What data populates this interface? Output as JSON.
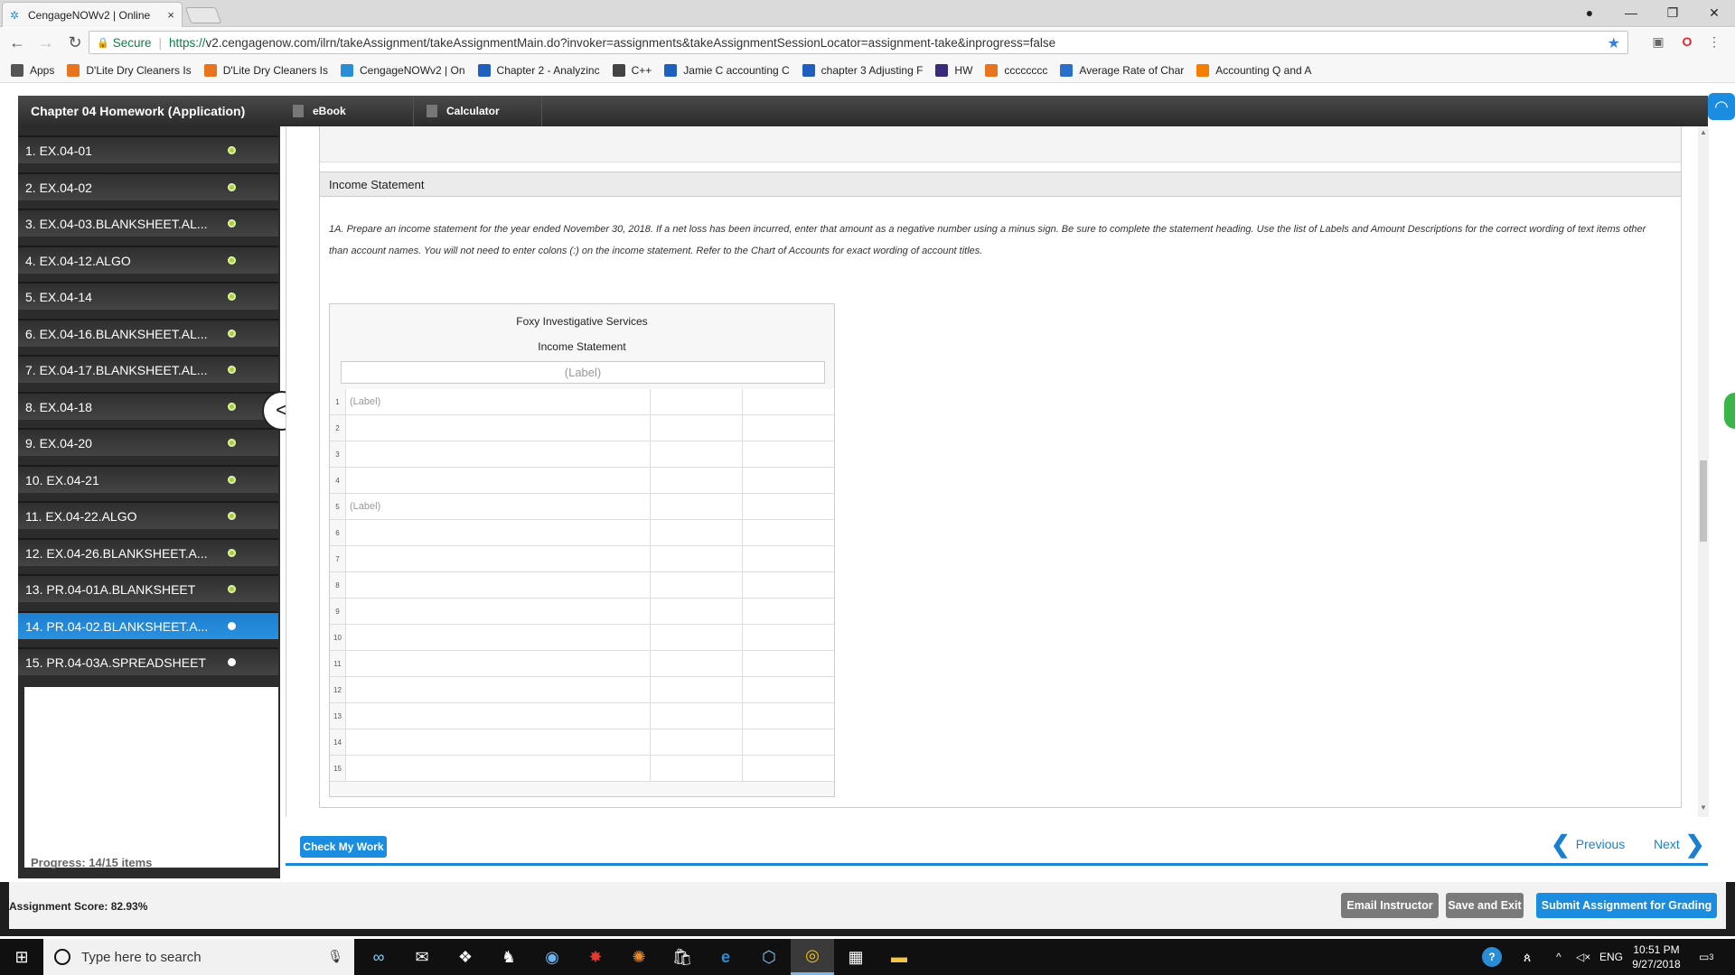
{
  "browser": {
    "tab_title": "CengageNOWv2 | Online",
    "tab_close": "×",
    "secure_label": "Secure",
    "url_https": "https://",
    "url_rest": "v2.cengagenow.com/ilrn/takeAssignment/takeAssignmentMain.do?invoker=assignments&takeAssignmentSessionLocator=assignment-take&inprogress=false",
    "bookmarks": [
      {
        "label": "Apps",
        "icon": "apps-icon",
        "color": "#555"
      },
      {
        "label": "D'Lite Dry Cleaners Is",
        "icon": "c-icon",
        "color": "#e8741e"
      },
      {
        "label": "D'Lite Dry Cleaners Is",
        "icon": "c-icon",
        "color": "#e8741e"
      },
      {
        "label": "CengageNOWv2 | On",
        "icon": "cengage-icon",
        "color": "#2b8dd6"
      },
      {
        "label": "Chapter 2 - Analyzinc",
        "icon": "q-icon",
        "color": "#1f5fbf"
      },
      {
        "label": "C++",
        "icon": "cpp-icon",
        "color": "#444"
      },
      {
        "label": "Jamie C accounting C",
        "icon": "q-icon",
        "color": "#1f5fbf"
      },
      {
        "label": "chapter 3 Adjusting F",
        "icon": "q-icon",
        "color": "#1f5fbf"
      },
      {
        "label": "HW",
        "icon": "hw-icon",
        "color": "#3b2a7a"
      },
      {
        "label": "cccccccc",
        "icon": "c-icon",
        "color": "#e8741e"
      },
      {
        "label": "Average Rate of Char",
        "icon": "check-icon",
        "color": "#2a6fc9"
      },
      {
        "label": "Accounting Q and A",
        "icon": "b-icon",
        "color": "#f57d00"
      }
    ]
  },
  "assignment": {
    "title": "Chapter 04 Homework (Application)",
    "tools": {
      "ebook": "eBook",
      "calculator": "Calculator"
    },
    "questions": [
      {
        "label": "1. EX.04-01",
        "status": "done"
      },
      {
        "label": "2. EX.04-02",
        "status": "done"
      },
      {
        "label": "3. EX.04-03.BLANKSHEET.AL...",
        "status": "done"
      },
      {
        "label": "4. EX.04-12.ALGO",
        "status": "done"
      },
      {
        "label": "5. EX.04-14",
        "status": "done"
      },
      {
        "label": "6. EX.04-16.BLANKSHEET.AL...",
        "status": "done"
      },
      {
        "label": "7. EX.04-17.BLANKSHEET.AL...",
        "status": "done"
      },
      {
        "label": "8. EX.04-18",
        "status": "done"
      },
      {
        "label": "9. EX.04-20",
        "status": "done"
      },
      {
        "label": "10. EX.04-21",
        "status": "done"
      },
      {
        "label": "11. EX.04-22.ALGO",
        "status": "done"
      },
      {
        "label": "12. EX.04-26.BLANKSHEET.A...",
        "status": "done"
      },
      {
        "label": "13. PR.04-01A.BLANKSHEET",
        "status": "done"
      },
      {
        "label": "14. PR.04-02.BLANKSHEET.A...",
        "status": "active"
      },
      {
        "label": "15. PR.04-03A.SPREADSHEET",
        "status": "open"
      }
    ],
    "progress": "Progress:  14/15 items",
    "collapse_glyph": "<"
  },
  "problem": {
    "section_title": "Income Statement",
    "instructions": "1A. Prepare an income statement for the year ended November 30, 2018. If a net loss has been incurred, enter that amount as a negative number using a minus sign. Be sure to complete the statement heading. Use the list of Labels and Amount Descriptions for the correct wording of text items other than account names. You will not need to enter colons (:) on the income statement. Refer to the Chart of Accounts for exact wording of account titles.",
    "company": "Foxy Investigative Services",
    "statement_name": "Income Statement",
    "heading_placeholder": "(Label)",
    "rows": [
      {
        "n": "1",
        "label": "(Label)"
      },
      {
        "n": "2",
        "label": ""
      },
      {
        "n": "3",
        "label": ""
      },
      {
        "n": "4",
        "label": ""
      },
      {
        "n": "5",
        "label": "(Label)"
      },
      {
        "n": "6",
        "label": ""
      },
      {
        "n": "7",
        "label": ""
      },
      {
        "n": "8",
        "label": ""
      },
      {
        "n": "9",
        "label": ""
      },
      {
        "n": "10",
        "label": ""
      },
      {
        "n": "11",
        "label": ""
      },
      {
        "n": "12",
        "label": ""
      },
      {
        "n": "13",
        "label": ""
      },
      {
        "n": "14",
        "label": ""
      },
      {
        "n": "15",
        "label": ""
      }
    ]
  },
  "nav": {
    "check_my_work": "Check My Work",
    "previous": "Previous",
    "next": "Next"
  },
  "footer": {
    "score": "Assignment Score: 82.93%",
    "email_instructor": "Email Instructor",
    "save_and_exit": "Save and Exit",
    "submit": "Submit Assignment for Grading"
  },
  "taskbar": {
    "search_placeholder": "Type here to search",
    "language": "ENG",
    "time": "10:51 PM",
    "date": "9/27/2018",
    "notification_count": "3"
  },
  "colors": {
    "accent_blue": "#1a8de0",
    "done_green": "#a9cf3a",
    "sidebar_dark": "#2c2c2c"
  }
}
